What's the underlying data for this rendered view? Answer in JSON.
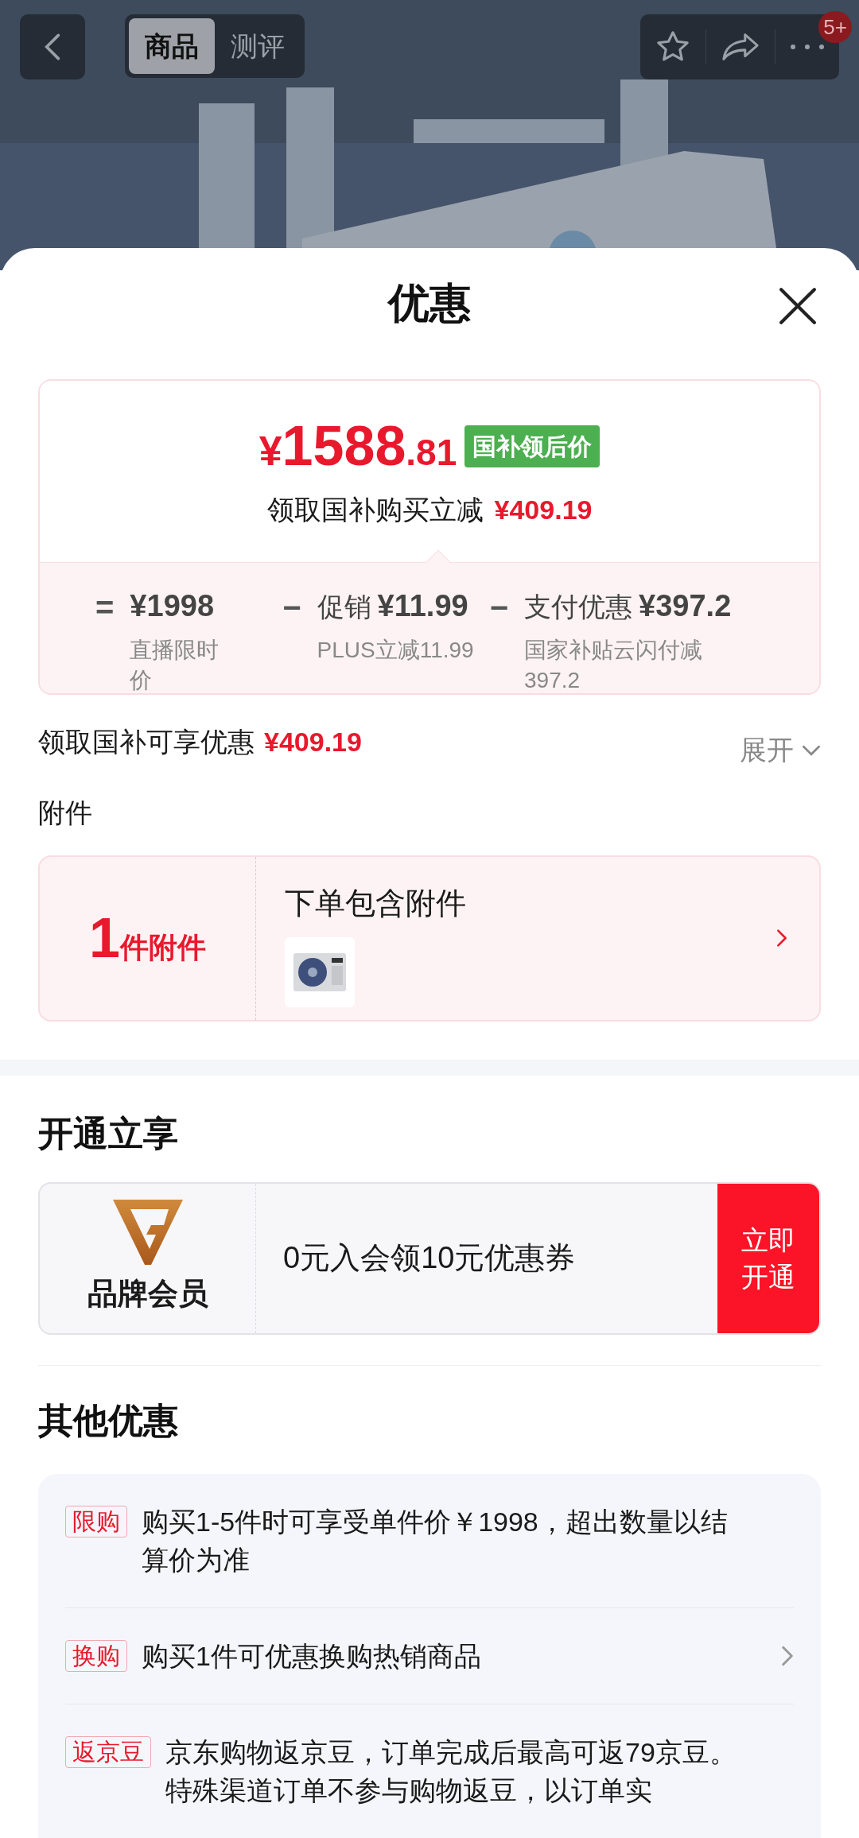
{
  "top_bar": {
    "tabs": [
      {
        "label": "商品",
        "selected": true
      },
      {
        "label": "测评",
        "selected": false
      }
    ],
    "badge": "5+"
  },
  "sheet": {
    "title": "优惠",
    "price_card": {
      "currency": "¥",
      "integer": "1588",
      "decimal": ".81",
      "tag": "国补领后价",
      "subtitle": "领取国补购买立减",
      "subtitle_amount": "¥409.19",
      "formula": [
        {
          "operator": "=",
          "amount": "¥1998",
          "note": "直播限时价"
        },
        {
          "operator": "−",
          "label": "促销",
          "amount": "¥11.99",
          "note": "PLUS立减11.99"
        },
        {
          "operator": "−",
          "label": "支付优惠",
          "amount": "¥397.2",
          "note": "国家补贴云闪付减397.2"
        }
      ]
    },
    "summary": {
      "label": "领取国补可享优惠",
      "amount": "¥409.19",
      "toggle": "展开"
    },
    "attachments": {
      "heading": "附件",
      "count": "1",
      "count_unit": "件附件",
      "description": "下单包含附件"
    },
    "membership": {
      "heading": "开通立享",
      "brand": "品牌会员",
      "offer": "0元入会领10元优惠券",
      "button": "立即开通"
    },
    "other_offers": {
      "heading": "其他优惠",
      "items": [
        {
          "tag": "限购",
          "text": "购买1-5件时可享受单件价￥1998，超出数量以结算价为准",
          "arrow": false
        },
        {
          "tag": "换购",
          "text": "购买1件可优惠换购热销商品",
          "arrow": true
        },
        {
          "tag": "返京豆",
          "text": "京东购物返京豆，订单完成后最高可返79京豆。特殊渠道订单不参与购物返豆，以订单实",
          "arrow": false
        }
      ]
    }
  }
}
